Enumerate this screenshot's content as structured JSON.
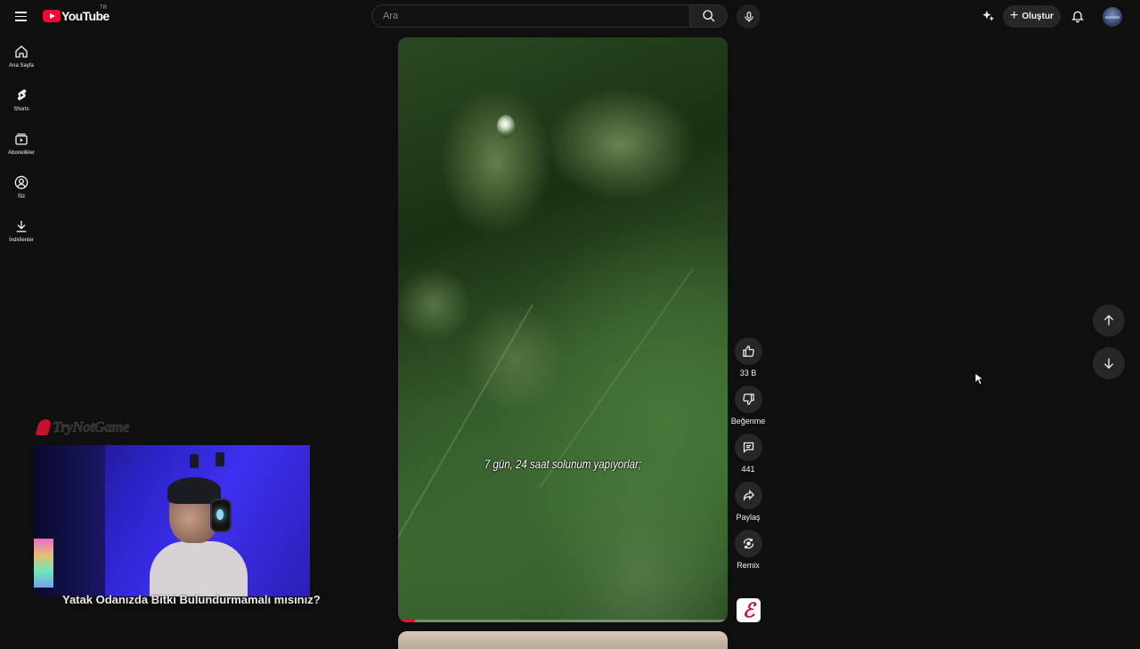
{
  "header": {
    "logo_text": "YouTube",
    "country_code": "TR",
    "search_placeholder": "Ara",
    "create_label": "Oluştur"
  },
  "sidebar": {
    "items": [
      {
        "label": "Ana Sayfa",
        "icon": "home-icon"
      },
      {
        "label": "Shorts",
        "icon": "shorts-icon"
      },
      {
        "label": "Abonelikler",
        "icon": "subscriptions-icon"
      },
      {
        "label": "Siz",
        "icon": "account-icon"
      },
      {
        "label": "İndirilenler",
        "icon": "download-icon"
      }
    ]
  },
  "video": {
    "caption": "7 gün, 24 saat solunum yapıyorlar;",
    "progress": 0.05
  },
  "actions": {
    "like_count": "33 B",
    "dislike_label": "Beğenme",
    "comment_count": "441",
    "share_label": "Paylaş",
    "remix_label": "Remix"
  },
  "overlay": {
    "brand": "TryNotGame",
    "title": "Yatak Odanızda Bitki Bulundurmamalı mısınız?"
  },
  "colors": {
    "background": "#0f0f0f",
    "accent": "#ff0033",
    "button_bg": "#272727"
  }
}
